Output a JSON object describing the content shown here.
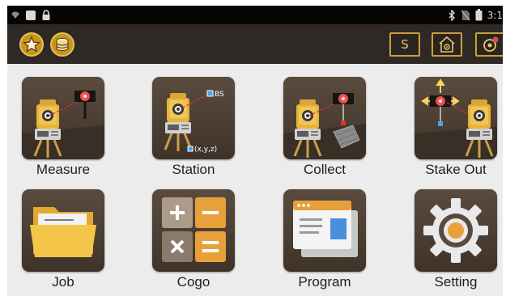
{
  "status_bar": {
    "time": "3:1",
    "icons": [
      "wifi-icon",
      "notification-icon",
      "lock-icon",
      "bluetooth-icon",
      "no-sim-icon",
      "battery-icon"
    ]
  },
  "toolbar": {
    "left": [
      "star-icon",
      "database-icon"
    ],
    "right": {
      "s_label": "S",
      "icons": [
        "home-settings-icon",
        "target-icon"
      ]
    }
  },
  "tiles": [
    {
      "label": "Measure",
      "icon": "measure-icon"
    },
    {
      "label": "Station",
      "icon": "station-icon",
      "bs_label": "BS",
      "coord_label": "(x,y,z)"
    },
    {
      "label": "Collect",
      "icon": "collect-icon"
    },
    {
      "label": "Stake Out",
      "icon": "stake-out-icon"
    },
    {
      "label": "Job",
      "icon": "job-folder-icon"
    },
    {
      "label": "Cogo",
      "icon": "cogo-calculator-icon"
    },
    {
      "label": "Program",
      "icon": "program-window-icon"
    },
    {
      "label": "Setting",
      "icon": "setting-gear-icon"
    }
  ],
  "colors": {
    "toolbar_bg": "#2e2924",
    "accent": "#c8951a",
    "tile_bg": "#4a3d32",
    "page_bg": "#ececec"
  }
}
